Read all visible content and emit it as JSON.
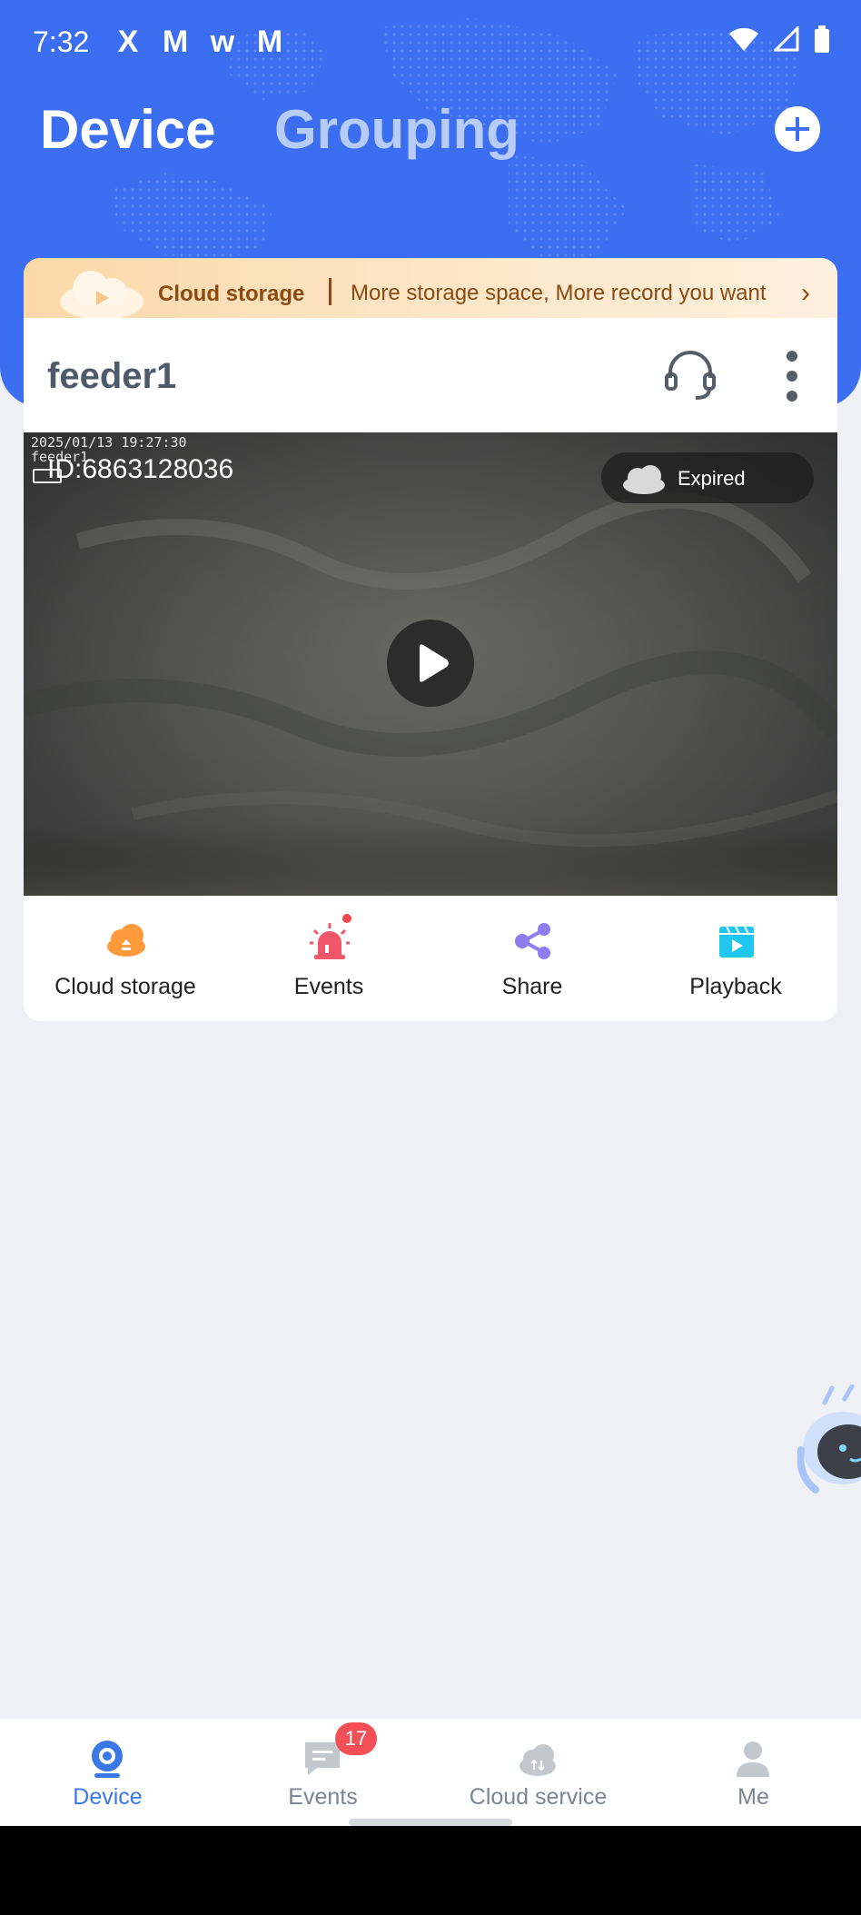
{
  "status_bar": {
    "time": "7:32",
    "notifications": [
      "X",
      "M",
      "w",
      "M"
    ]
  },
  "header": {
    "tab_device": "Device",
    "tab_grouping": "Grouping",
    "add_icon": "plus-circle-icon"
  },
  "banner": {
    "title": "Cloud storage",
    "text": "More storage space, More record you want",
    "chevron": "›"
  },
  "device": {
    "name": "feeder1",
    "support_icon": "headset-icon",
    "more_icon": "more-vertical-icon",
    "video": {
      "timestamp": "2025/01/13 19:27:30",
      "osd_name": "feeder1",
      "device_id": "ID:6863128036",
      "cloud_status": "Expired"
    },
    "actions": [
      {
        "label": "Cloud storage",
        "icon": "cloud-upload-icon",
        "color": "#ff9a3c"
      },
      {
        "label": "Events",
        "icon": "alarm-light-icon",
        "color": "#f2566a"
      },
      {
        "label": "Share",
        "icon": "share-icon",
        "color": "#8e7cf0"
      },
      {
        "label": "Playback",
        "icon": "playback-icon",
        "color": "#1ec6f0"
      }
    ]
  },
  "bottom_nav": {
    "items": [
      {
        "label": "Device",
        "icon": "camera-icon",
        "active": true
      },
      {
        "label": "Events",
        "icon": "message-icon",
        "badge": "17"
      },
      {
        "label": "Cloud service",
        "icon": "cloud-icon"
      },
      {
        "label": "Me",
        "icon": "person-icon"
      }
    ]
  },
  "colors": {
    "header_blue": "#3b6ef0",
    "active_nav": "#3b78e7",
    "badge_red": "#f24f57",
    "background": "#eef0f6"
  }
}
